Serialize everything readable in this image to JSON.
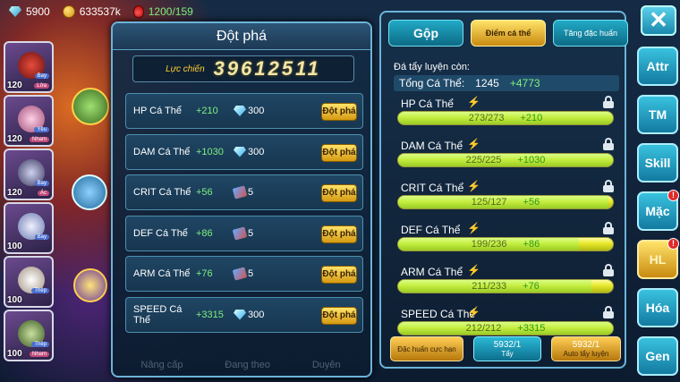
{
  "top": {
    "gems": "5900",
    "gold": "633537k",
    "energy": "1200/159"
  },
  "pets": [
    {
      "level": "120",
      "tag1": "Bay",
      "tag2": "Lửa",
      "color": "#c0392b"
    },
    {
      "level": "120",
      "tag1": "Yêu",
      "tag2": "Nham",
      "color": "#e8a0c0"
    },
    {
      "level": "120",
      "tag1": "Bay",
      "tag2": "Ác",
      "color": "#5a5a80"
    },
    {
      "level": "100",
      "tag1": "Bay",
      "tag2": "",
      "color": "#a0b8e0"
    },
    {
      "level": "100",
      "tag1": "Thép",
      "tag2": "",
      "color": "#e0d0c0"
    },
    {
      "level": "100",
      "tag1": "Thép",
      "tag2": "Nham",
      "color": "#6a8a50"
    }
  ],
  "panel": {
    "title": "Đột phá",
    "power_label": "Lực chiến",
    "power_value": "39612511",
    "rows": [
      {
        "name": "HP Cá Thể",
        "inc": "+210",
        "cost": "300",
        "icon": "diamond-icon",
        "button": "Đột phá"
      },
      {
        "name": "DAM Cá Thể",
        "inc": "+1030",
        "cost": "300",
        "icon": "diamond-icon",
        "button": "Đột phá"
      },
      {
        "name": "CRIT Cá Thể",
        "inc": "+56",
        "cost": "5",
        "icon": "scroll-icon",
        "button": "Đột phá"
      },
      {
        "name": "DEF Cá Thể",
        "inc": "+86",
        "cost": "5",
        "icon": "scroll-icon",
        "button": "Đột phá"
      },
      {
        "name": "ARM Cá Thể",
        "inc": "+76",
        "cost": "5",
        "icon": "scroll-icon",
        "button": "Đột phá"
      },
      {
        "name": "SPEED Cá Thể",
        "inc": "+3315",
        "cost": "300",
        "icon": "diamond-icon",
        "button": "Đột phá"
      }
    ],
    "footer": [
      "Nâng cấp",
      "Đang theo",
      "Duyên"
    ]
  },
  "right": {
    "tabs": [
      "Gộp",
      "Điểm cá thể",
      "Tăng đặc huấn"
    ],
    "remaining_label": "Đá tẩy luyện còn:",
    "total_label": "Tổng Cá Thể:",
    "total_value": "1245",
    "total_bonus": "+4773",
    "stats": [
      {
        "name": "HP Cá Thể",
        "value": "273/273",
        "bonus": "+210",
        "fill": 1.0
      },
      {
        "name": "DAM Cá Thể",
        "value": "225/225",
        "bonus": "+1030",
        "fill": 1.0
      },
      {
        "name": "CRIT Cá Thể",
        "value": "125/127",
        "bonus": "+56",
        "fill": 0.98
      },
      {
        "name": "DEF Cá Thể",
        "value": "199/236",
        "bonus": "+86",
        "fill": 0.84
      },
      {
        "name": "ARM Cá Thể",
        "value": "211/233",
        "bonus": "+76",
        "fill": 0.9
      },
      {
        "name": "SPEED Cá Thể",
        "value": "212/212",
        "bonus": "+3315",
        "fill": 1.0
      }
    ],
    "actions": [
      {
        "label": "Đặc huấn cực hạn",
        "count": ""
      },
      {
        "label": "Tẩy",
        "count": "5932/1"
      },
      {
        "label": "Auto tẩy luyện",
        "count": "5932/1"
      }
    ]
  },
  "side": {
    "close": "✕",
    "buttons": [
      {
        "label": "Attr",
        "badge": ""
      },
      {
        "label": "TM",
        "badge": ""
      },
      {
        "label": "Skill",
        "badge": ""
      },
      {
        "label": "Mặc",
        "badge": "!"
      },
      {
        "label": "HL",
        "badge": "!"
      },
      {
        "label": "Hóa",
        "badge": ""
      },
      {
        "label": "Gen",
        "badge": ""
      }
    ]
  }
}
